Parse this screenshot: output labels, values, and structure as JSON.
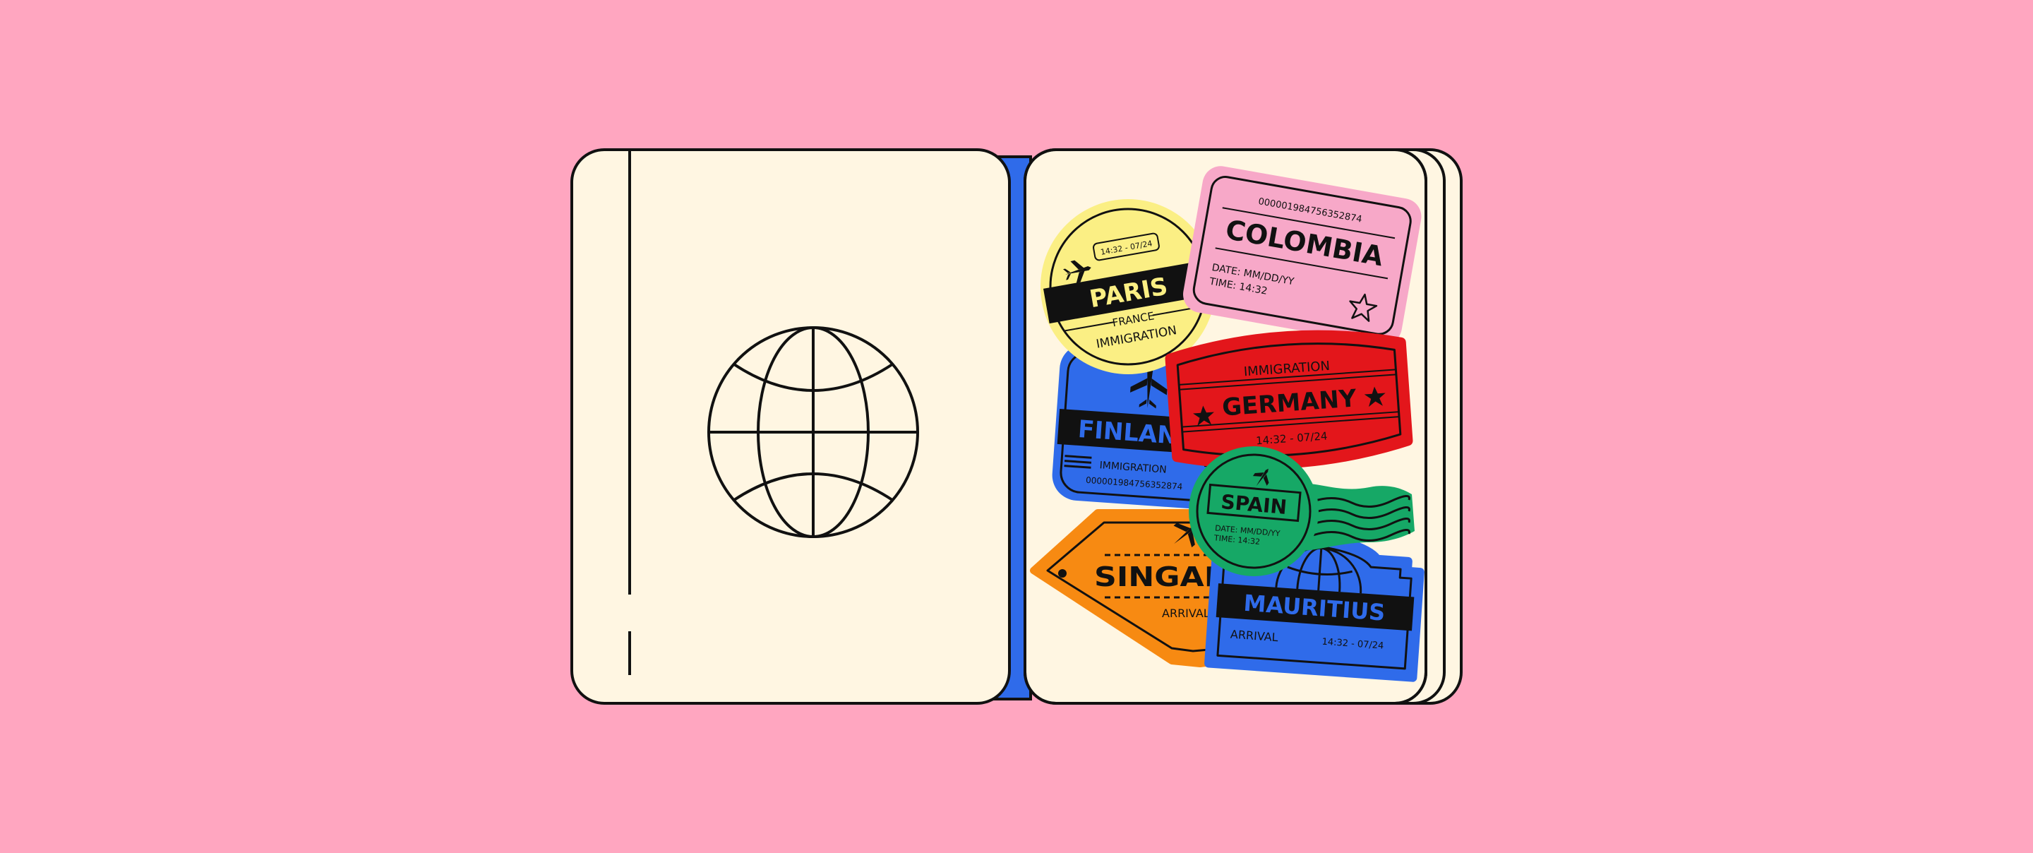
{
  "colors": {
    "background": "#FFA6C0",
    "page": "#FFF6E2",
    "outline": "#111111",
    "cover": "#2F6BEA",
    "yellow": "#FBEF84",
    "pink": "#F7A8C8",
    "red": "#E3161B",
    "blue": "#2F6BEA",
    "green": "#16A866",
    "orange": "#F78A12"
  },
  "stamps": {
    "colombia": {
      "number": "0000019847563528​74",
      "name": "COLOMBIA",
      "date": "DATE: MM/DD/YY",
      "time": "TIME: 14:32"
    },
    "paris": {
      "time": "14:32 - 07/24",
      "name": "PARIS",
      "country": "FRANCE",
      "label": "IMMIGRATION"
    },
    "germany": {
      "label": "IMMIGRATION",
      "name": "GERMANY",
      "time": "14:32 - 07/24"
    },
    "finland": {
      "name": "FINLAND",
      "label": "IMMIGRATION",
      "number": "0000019847563528​74"
    },
    "spain": {
      "name": "SPAIN",
      "date": "DATE: MM/DD/YY",
      "time": "TIME: 14:32"
    },
    "singapore": {
      "name": "SINGAPORE",
      "label": "ARRIVAL"
    },
    "mauritius": {
      "name": "MAURITIUS",
      "label": "ARRIVAL",
      "time": "14:32 - 07/24"
    }
  }
}
